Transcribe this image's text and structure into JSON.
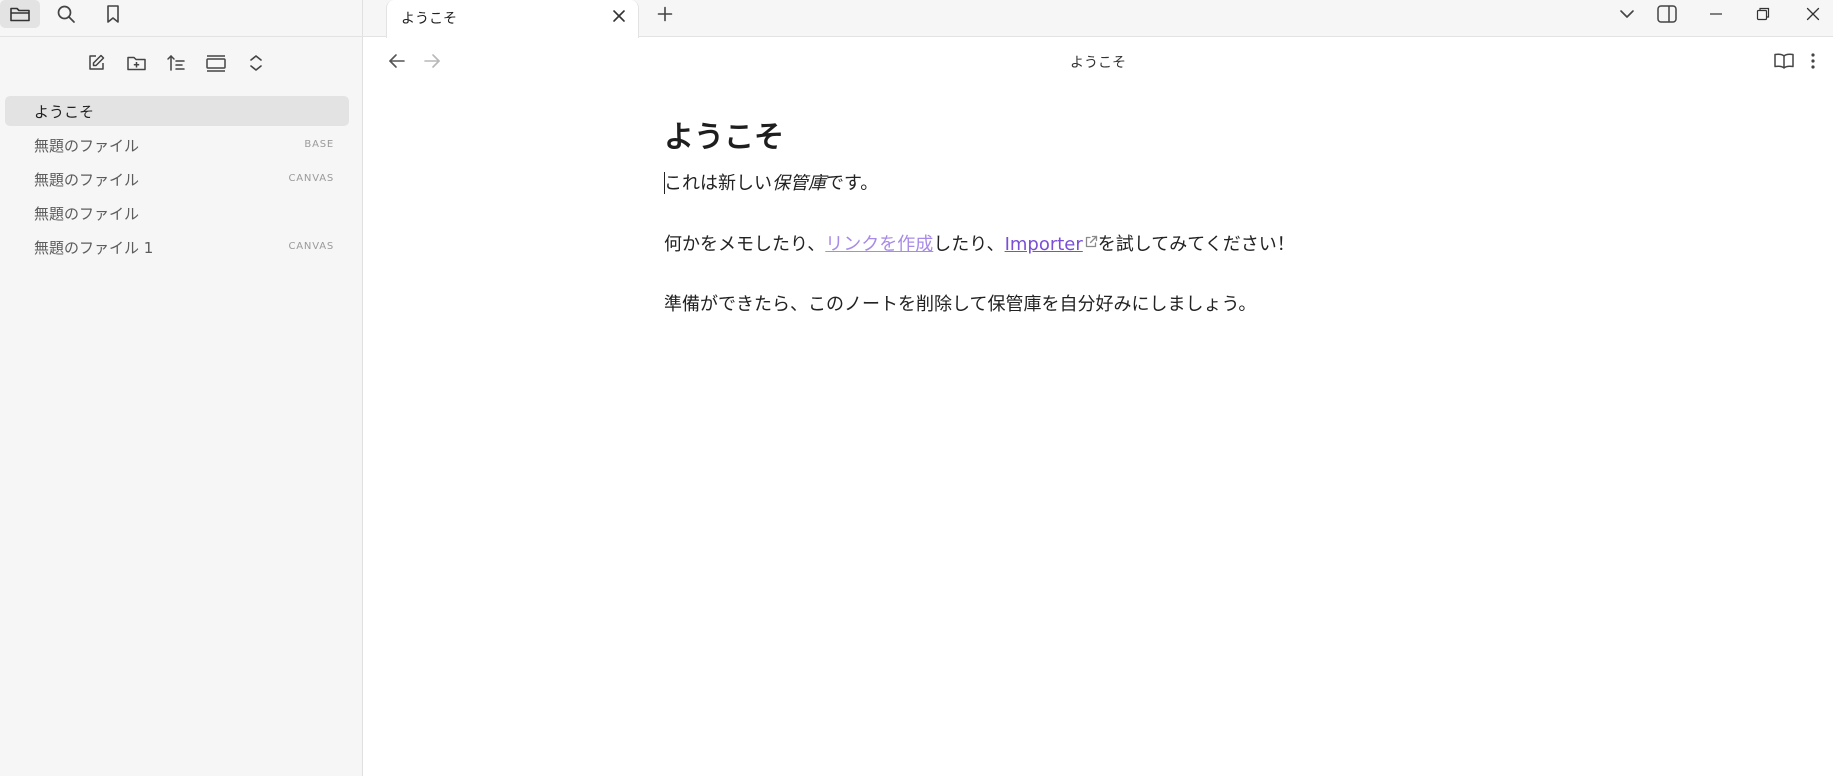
{
  "ribbon": {
    "items": [
      {
        "icon": "folder-icon",
        "active": true
      },
      {
        "icon": "search-icon",
        "active": false
      },
      {
        "icon": "bookmark-icon",
        "active": false
      }
    ]
  },
  "file_toolbar": {
    "items": [
      "new-note-icon",
      "new-folder-icon",
      "sort-icon",
      "collapse-view-icon",
      "expand-collapse-icon"
    ]
  },
  "files": [
    {
      "name": "ようこそ",
      "tag": "",
      "active": true
    },
    {
      "name": "無題のファイル",
      "tag": "BASE",
      "active": false
    },
    {
      "name": "無題のファイル",
      "tag": "CANVAS",
      "active": false
    },
    {
      "name": "無題のファイル",
      "tag": "",
      "active": false
    },
    {
      "name": "無題のファイル 1",
      "tag": "CANVAS",
      "active": false
    }
  ],
  "tabs": [
    {
      "title": "ようこそ"
    }
  ],
  "view": {
    "title": "ようこそ"
  },
  "note": {
    "title": "ようこそ",
    "p1": {
      "before": "これは新しい",
      "em": "保管庫",
      "after": "です。"
    },
    "p2": {
      "before": "何かをメモしたり、",
      "link1": "リンクを作成",
      "middle": "したり、",
      "link2": "Importer",
      "after": "を試してみてください！"
    },
    "p3": "準備ができたら、このノートを削除して保管庫を自分好みにしましょう。"
  },
  "colors": {
    "accent": "#7a4fd6",
    "internal_link": "#a88be6",
    "sidebar_bg": "#f6f6f6",
    "active_item_bg": "#e3e3e3"
  }
}
